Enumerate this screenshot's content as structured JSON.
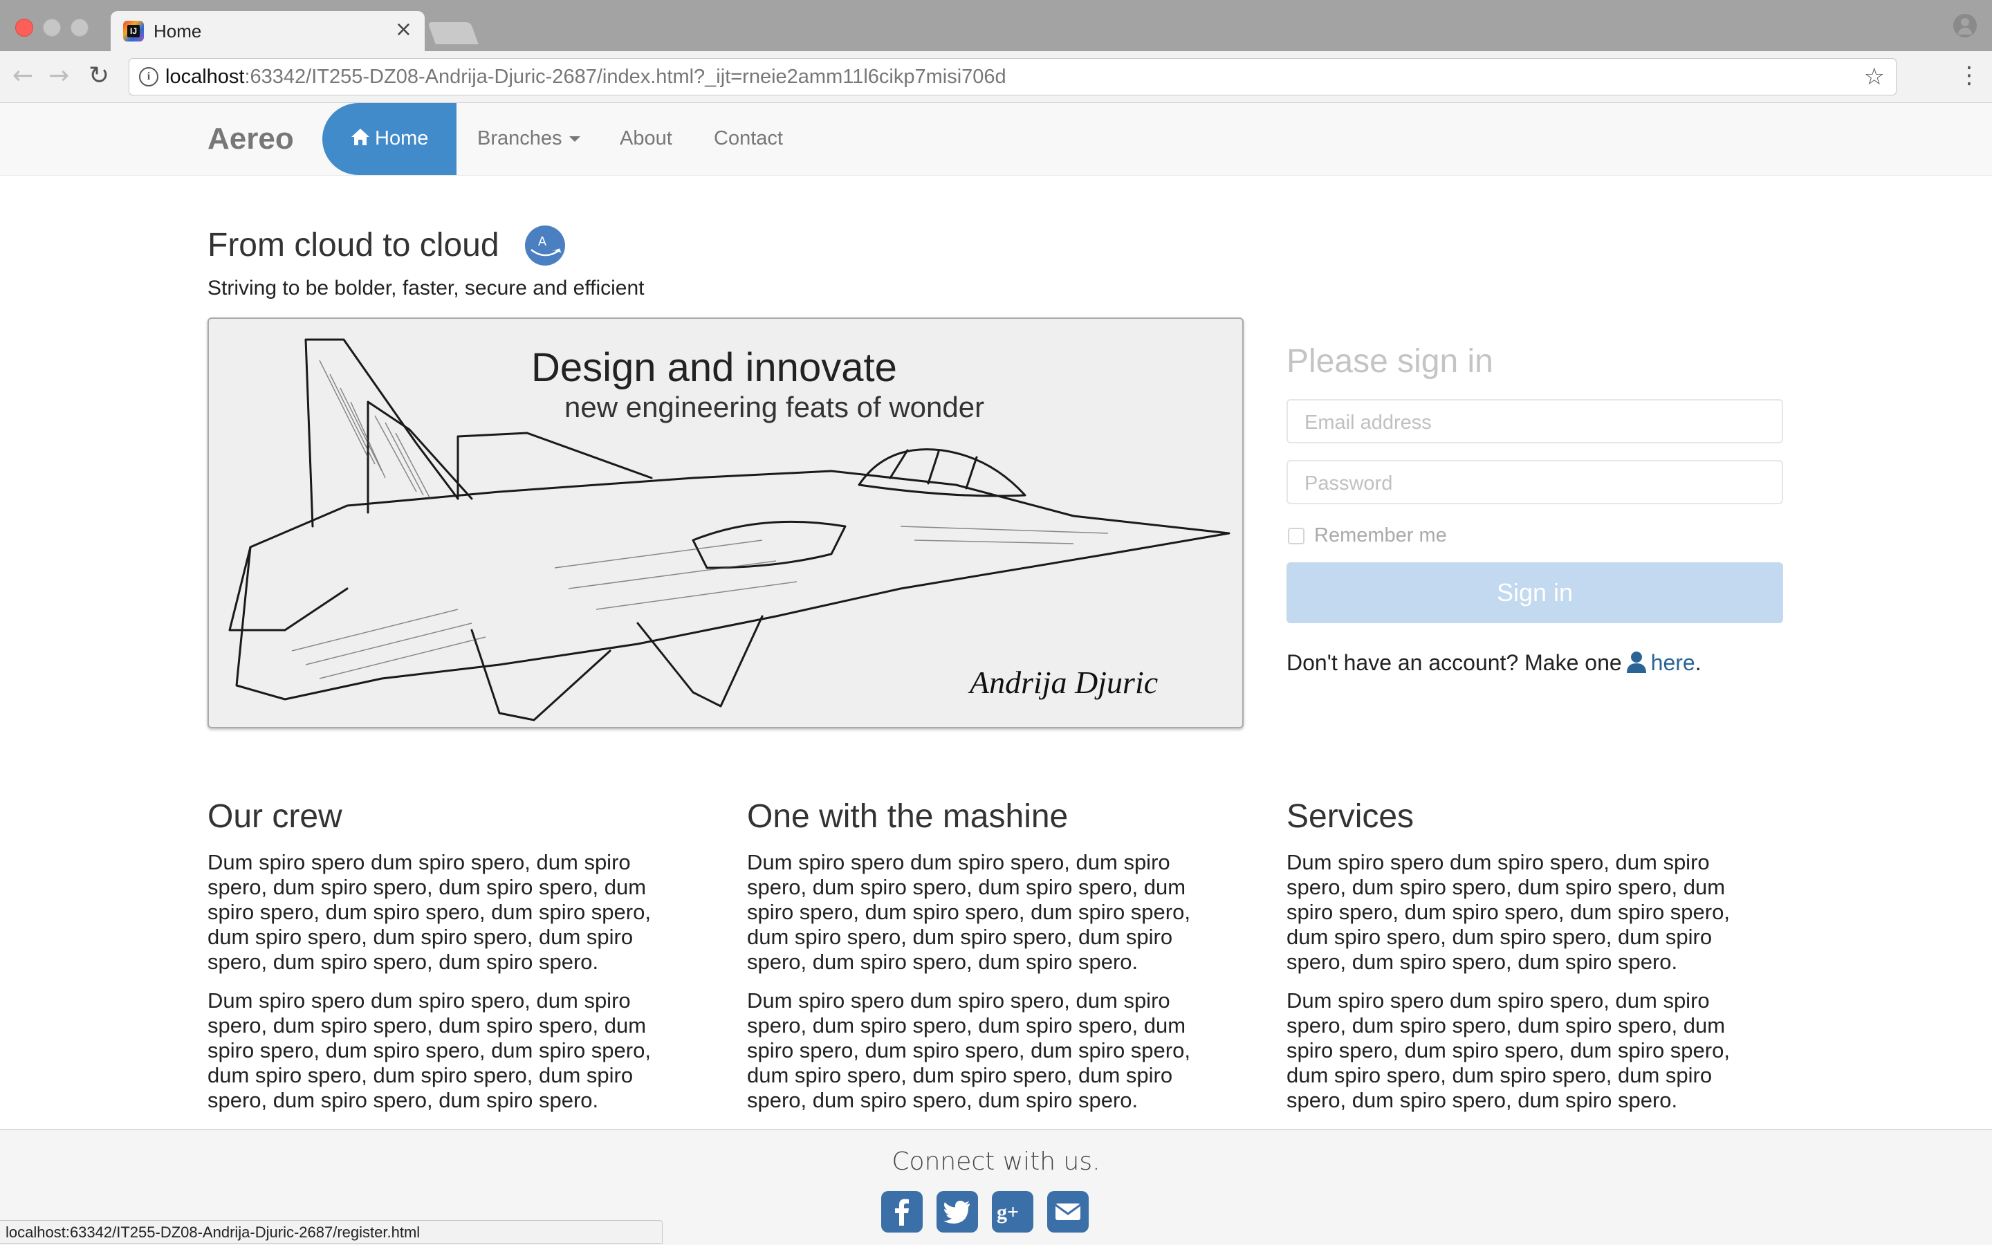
{
  "browser": {
    "tab_title": "Home",
    "tab_close": "×",
    "url_host": "localhost",
    "url_rest": ":63342/IT255-DZ08-Andrija-Djuric-2687/index.html?_ijt=rneie2amm11l6cikp7misi706d",
    "status_url": "localhost:63342/IT255-DZ08-Andrija-Djuric-2687/register.html"
  },
  "navbar": {
    "brand": "Aereo",
    "home": "Home",
    "branches": "Branches",
    "about": "About",
    "contact": "Contact",
    "active_color": "#428bca"
  },
  "hero": {
    "title": "From cloud to cloud",
    "subtitle": "Striving to be bolder, faster, secure and efficient"
  },
  "banner": {
    "heading": "Design and innovate",
    "subheading": "new engineering feats of wonder",
    "signature": "Andrija Djuric"
  },
  "signin": {
    "title": "Please sign in",
    "email_placeholder": "Email address",
    "password_placeholder": "Password",
    "remember_label": "Remember me",
    "button_label": "Sign in",
    "register_text": "Don't have an account? Make one",
    "register_link": "here",
    "register_end": "."
  },
  "columns": [
    {
      "title": "Our crew",
      "paragraphs": [
        "Dum spiro spero dum spiro spero, dum spiro spero, dum spiro spero, dum spiro spero, dum spiro spero, dum spiro spero, dum spiro spero, dum spiro spero, dum spiro spero, dum spiro spero, dum spiro spero, dum spiro spero.",
        "Dum spiro spero dum spiro spero, dum spiro spero, dum spiro spero, dum spiro spero, dum spiro spero, dum spiro spero, dum spiro spero, dum spiro spero, dum spiro spero, dum spiro spero, dum spiro spero, dum spiro spero."
      ]
    },
    {
      "title": "One with the mashine",
      "paragraphs": [
        "Dum spiro spero dum spiro spero, dum spiro spero, dum spiro spero, dum spiro spero, dum spiro spero, dum spiro spero, dum spiro spero, dum spiro spero, dum spiro spero, dum spiro spero, dum spiro spero, dum spiro spero.",
        "Dum spiro spero dum spiro spero, dum spiro spero, dum spiro spero, dum spiro spero, dum spiro spero, dum spiro spero, dum spiro spero, dum spiro spero, dum spiro spero, dum spiro spero, dum spiro spero, dum spiro spero."
      ]
    },
    {
      "title": "Services",
      "paragraphs": [
        "Dum spiro spero dum spiro spero, dum spiro spero, dum spiro spero, dum spiro spero, dum spiro spero, dum spiro spero, dum spiro spero, dum spiro spero, dum spiro spero, dum spiro spero, dum spiro spero, dum spiro spero.",
        "Dum spiro spero dum spiro spero, dum spiro spero, dum spiro spero, dum spiro spero, dum spiro spero, dum spiro spero, dum spiro spero, dum spiro spero, dum spiro spero, dum spiro spero, dum spiro spero, dum spiro spero."
      ]
    }
  ],
  "footer": {
    "text": "Connect with us.",
    "icons": [
      "facebook-icon",
      "twitter-icon",
      "google-plus-icon",
      "envelope-icon"
    ]
  }
}
